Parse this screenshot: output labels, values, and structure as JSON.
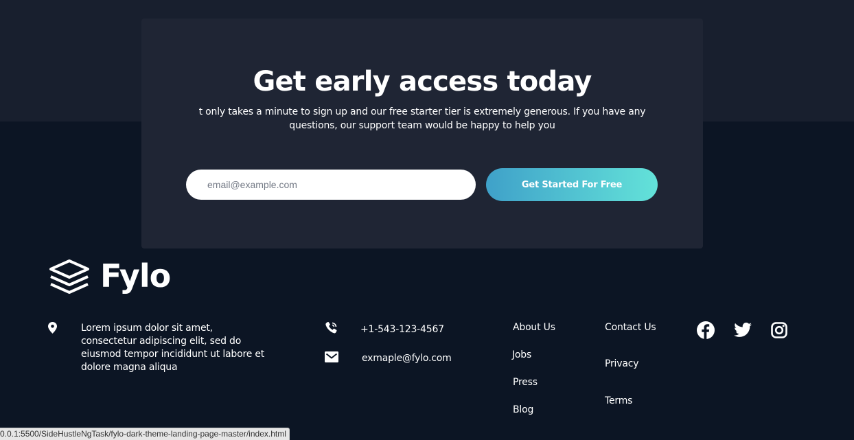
{
  "signup": {
    "title": "Get early access today",
    "description": "t only takes a minute to sign up and our free starter tier is extremely generous. If you have any questions, our support team would be happy to help you",
    "email_placeholder": "email@example.com",
    "cta_label": "Get Started For Free"
  },
  "footer": {
    "logo_text": "Fylo",
    "address": "Lorem ipsum dolor sit amet, consectetur adipiscing elit, sed do eiusmod tempor incididunt ut labore et dolore magna aliqua",
    "phone": "+1-543-123-4567",
    "email": "exmaple@fylo.com",
    "links_col1": [
      "About Us",
      "Jobs",
      "Press",
      "Blog"
    ],
    "links_col2": [
      "Contact Us",
      "Privacy",
      "Terms"
    ],
    "social": [
      "facebook-icon",
      "twitter-icon",
      "instagram-icon"
    ]
  },
  "status_bar": {
    "url": "0.0.1:5500/SideHustleNgTask/fylo-dark-theme-landing-page-master/index.html"
  },
  "colors": {
    "page_bg": "#0c1524",
    "top_band_bg": "#181f2e",
    "card_bg": "#1f2534",
    "cta_gradient_start": "#3fa1c9",
    "cta_gradient_end": "#63e2d9"
  }
}
